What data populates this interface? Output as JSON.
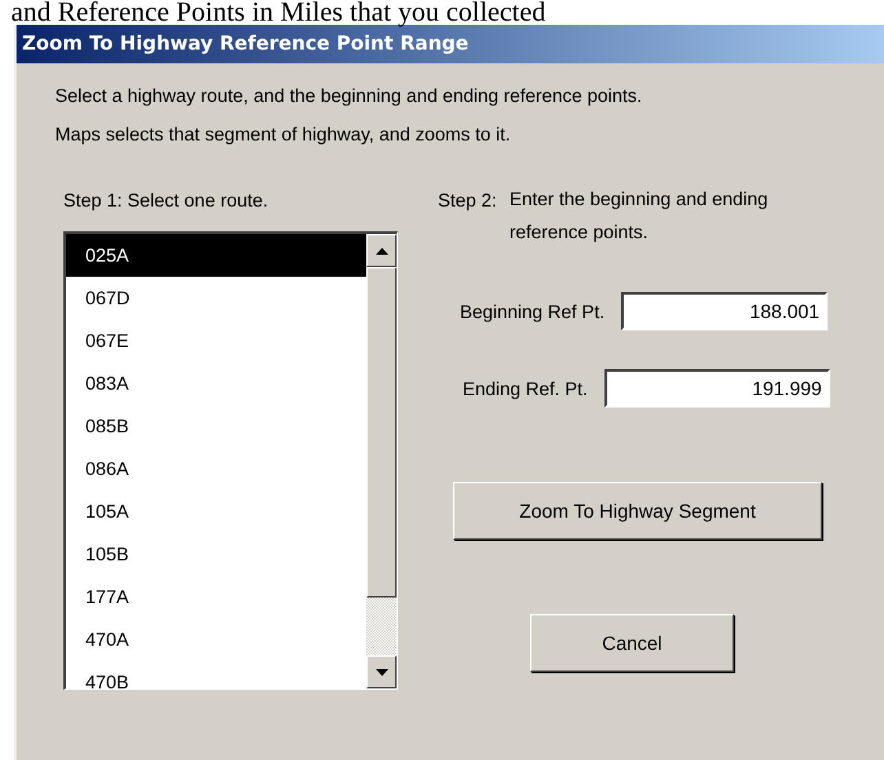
{
  "document_line": "and Reference Points in Miles that you collected",
  "dialog": {
    "title": "Zoom To Highway Reference Point Range",
    "instructions": [
      "Select a highway route, and the beginning and ending reference points.",
      "Maps selects that segment of highway, and zooms to it."
    ],
    "step1": "Step 1:  Select one route.",
    "step2": {
      "label": "Step 2:",
      "text": "Enter the beginning and ending reference points."
    },
    "routes": [
      {
        "label": "025A",
        "selected": true
      },
      {
        "label": "067D",
        "selected": false
      },
      {
        "label": "067E",
        "selected": false
      },
      {
        "label": "083A",
        "selected": false
      },
      {
        "label": "085B",
        "selected": false
      },
      {
        "label": "086A",
        "selected": false
      },
      {
        "label": "105A",
        "selected": false
      },
      {
        "label": "105B",
        "selected": false
      },
      {
        "label": "177A",
        "selected": false
      },
      {
        "label": "470A",
        "selected": false
      },
      {
        "label": "470B",
        "selected": false
      }
    ],
    "fields": [
      {
        "label": "Beginning Ref Pt.",
        "value": "188.001"
      },
      {
        "label": "Ending Ref. Pt.",
        "value": "191.999"
      }
    ],
    "buttons": [
      "Zoom To Highway Segment",
      "Cancel"
    ]
  }
}
